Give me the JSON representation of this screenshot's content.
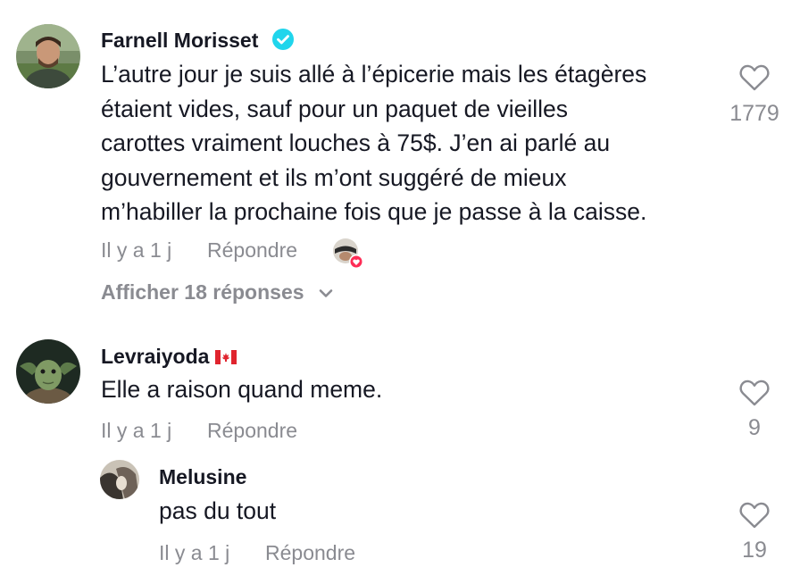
{
  "colors": {
    "text_primary": "#161823",
    "text_secondary": "#8a8b91",
    "verified_blue": "#20D5EC",
    "like_badge": "#FE2C55"
  },
  "comments": [
    {
      "username": "Farnell Morisset",
      "verified": true,
      "text_lines": [
        "L’autre jour je suis allé à l’épicerie mais les étagères",
        "étaient vides, sauf pour un paquet de vieilles",
        "carottes vraiment louches à 75$. J’en ai parlé au",
        "gouvernement et ils m’ont suggéré de mieux",
        "m’habiller la prochaine fois que je passe à la caisse."
      ],
      "time": "Il y a 1 j",
      "reply_label": "Répondre",
      "like_count": "1779",
      "view_replies_label": "Afficher 18 réponses"
    },
    {
      "username": "Levraiyoda",
      "flag_icon": "canada-flag-icon",
      "text": "Elle a raison quand meme.",
      "time": "Il y a 1 j",
      "reply_label": "Répondre",
      "like_count": "9"
    }
  ],
  "replies": [
    {
      "username": "Melusine",
      "text": "pas du tout",
      "time": "Il y a 1 j",
      "reply_label": "Répondre",
      "like_count": "19"
    }
  ]
}
